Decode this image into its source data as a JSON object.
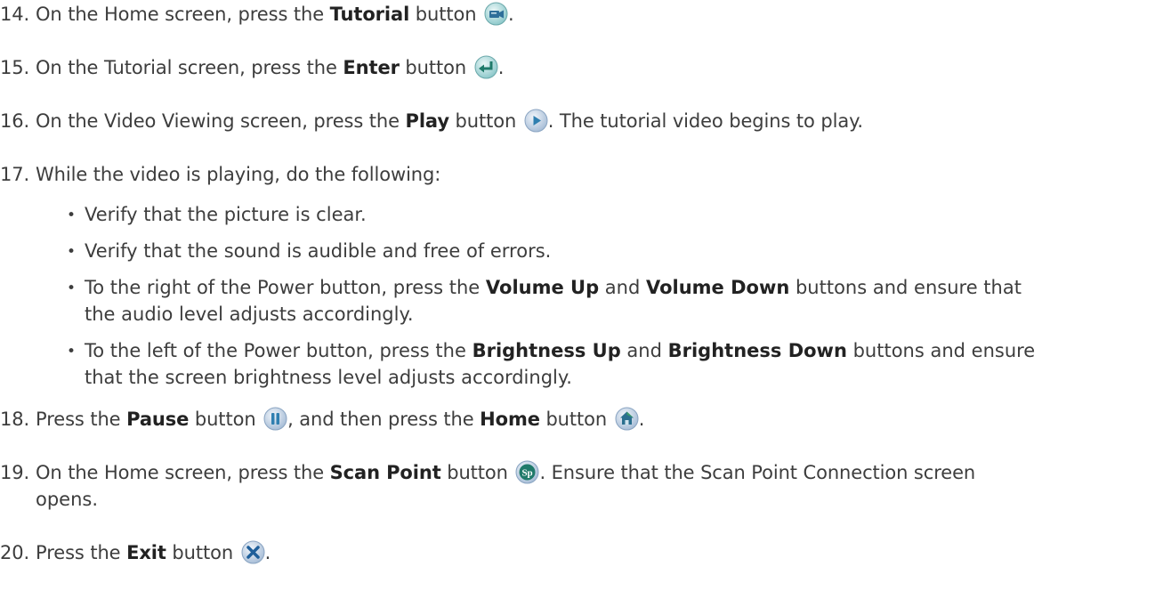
{
  "steps": [
    {
      "num": "14.",
      "pre": "On the Home screen, press the ",
      "bold": "Tutorial",
      "post": " button",
      "icon": "tutorial-icon",
      "tail": "."
    },
    {
      "num": "15.",
      "pre": "On the Tutorial screen, press the ",
      "bold": "Enter",
      "post": " button",
      "icon": "enter-icon",
      "tail": "."
    },
    {
      "num": "16.",
      "pre": "On the Video Viewing screen, press the ",
      "bold": "Play",
      "post": " button",
      "icon": "play-icon",
      "tail": ". The tutorial video begins to play."
    },
    {
      "num": "17.",
      "text": "While the video is playing, do the following:"
    },
    {
      "num": "18.",
      "pre": "Press the ",
      "bold": "Pause",
      "post": " button",
      "icon": "pause-icon",
      "mid": ", and then press the ",
      "bold2": "Home",
      "post2": " button",
      "icon2": "home-icon",
      "tail": "."
    },
    {
      "num": "19.",
      "pre": "On the Home screen, press the ",
      "bold": "Scan Point",
      "post": " button",
      "icon": "scan-point-icon",
      "tail": ". Ensure that the Scan Point Connection screen",
      "cont": "opens."
    },
    {
      "num": "20.",
      "pre": "Press the ",
      "bold": "Exit",
      "post": " button",
      "icon": "exit-icon",
      "tail": "."
    }
  ],
  "bullets": [
    {
      "text": "Verify that the picture is clear."
    },
    {
      "text": "Verify that the sound is audible and free of errors."
    },
    {
      "pre": "To the right of the Power button, press the ",
      "bold": "Volume Up",
      "mid": " and ",
      "bold2": "Volume Down",
      "post": " buttons and ensure that",
      "cont": "the audio level adjusts accordingly."
    },
    {
      "pre": "To the left of the Power button, press the ",
      "bold": "Brightness Up",
      "mid": " and ",
      "bold2": "Brightness Down",
      "post": " buttons and ensure",
      "cont": "that the screen brightness level adjusts accordingly."
    }
  ],
  "bullet_char": "•",
  "colors": {
    "text": "#3d3d3d",
    "icon_teal": "#2f9a9a",
    "icon_blue": "#3a6fb0",
    "icon_green": "#1f7a6a"
  }
}
